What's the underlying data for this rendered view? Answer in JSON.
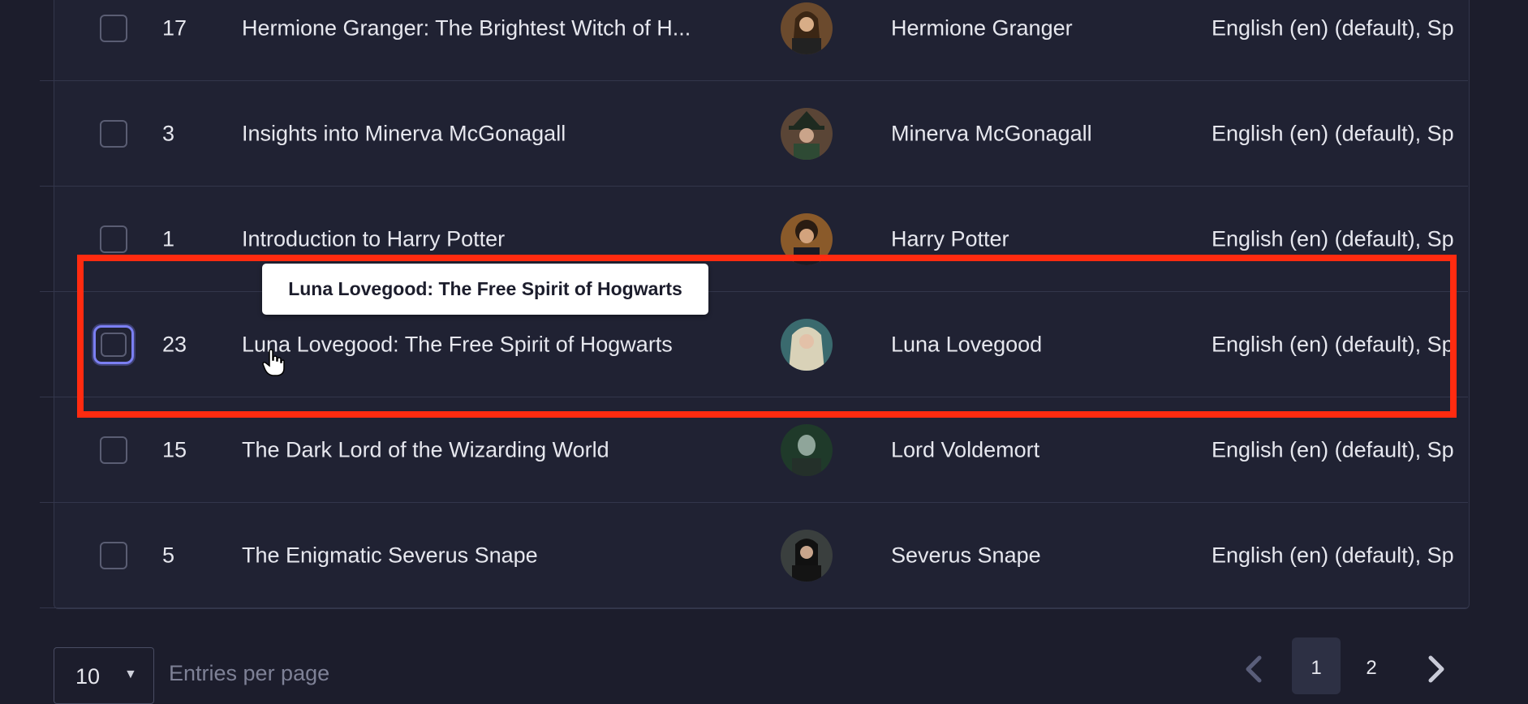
{
  "table": {
    "rows": [
      {
        "id": "17",
        "title": "Hermione Granger: The Brightest Witch of H...",
        "name": "Hermione Granger",
        "languages": "English (en) (default), Sp"
      },
      {
        "id": "3",
        "title": "Insights into Minerva McGonagall",
        "name": "Minerva McGonagall",
        "languages": "English (en) (default), Sp"
      },
      {
        "id": "1",
        "title": "Introduction to Harry Potter",
        "name": "Harry Potter",
        "languages": "English (en) (default), Sp"
      },
      {
        "id": "23",
        "title": "Luna Lovegood: The Free Spirit of Hogwarts",
        "name": "Luna Lovegood",
        "languages": "English (en) (default), Sp"
      },
      {
        "id": "15",
        "title": "The Dark Lord of the Wizarding World",
        "name": "Lord Voldemort",
        "languages": "English (en) (default), Sp"
      },
      {
        "id": "5",
        "title": "The Enigmatic Severus Snape",
        "name": "Severus Snape",
        "languages": "English (en) (default), Sp"
      }
    ]
  },
  "tooltip": {
    "text": "Luna Lovegood: The Free Spirit of Hogwarts"
  },
  "footer": {
    "per_page": "10",
    "entries_label": "Entries per page",
    "pages": [
      "1",
      "2"
    ],
    "current_page": "1"
  },
  "colors": {
    "background": "#1c1d2c",
    "panel": "#202233",
    "highlight": "#ff2b10",
    "focus": "#7b7ff2"
  }
}
